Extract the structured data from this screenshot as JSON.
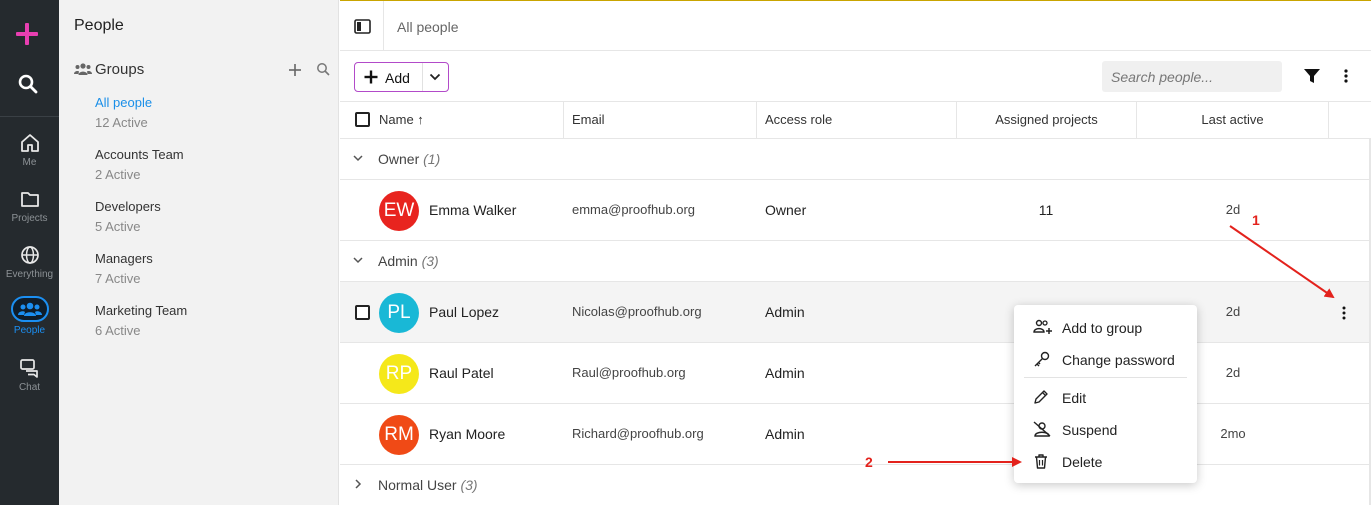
{
  "rail": {
    "items": [
      {
        "label": "Me",
        "icon": "home-icon"
      },
      {
        "label": "Projects",
        "icon": "folder-icon"
      },
      {
        "label": "Everything",
        "icon": "globe-icon"
      },
      {
        "label": "People",
        "icon": "people-icon",
        "active": true
      },
      {
        "label": "Chat",
        "icon": "chat-icon"
      }
    ],
    "accent": "#1b8ff2",
    "plus_color": "#e83fb1"
  },
  "panel": {
    "title": "People",
    "groups_label": "Groups",
    "groups": [
      {
        "name": "All people",
        "count": "12 Active",
        "selected": true
      },
      {
        "name": "Accounts Team",
        "count": "2 Active"
      },
      {
        "name": "Developers",
        "count": "5 Active"
      },
      {
        "name": "Managers",
        "count": "7 Active"
      },
      {
        "name": "Marketing Team",
        "count": "6 Active"
      }
    ]
  },
  "header": {
    "breadcrumb": "All people",
    "add_label": "Add",
    "search_placeholder": "Search people..."
  },
  "table": {
    "columns": [
      "Name ↑",
      "Email",
      "Access role",
      "Assigned projects",
      "Last active"
    ],
    "sections": [
      {
        "name": "Owner",
        "count": "(1)"
      },
      {
        "name": "Admin",
        "count": "(3)"
      },
      {
        "name": "Normal User",
        "count": "(3)"
      }
    ],
    "rows": [
      {
        "initials": "EW",
        "name": "Emma Walker",
        "email": "emma@proofhub.org",
        "role": "Owner",
        "projects": "11",
        "last_active": "2d",
        "color": "#e8241f"
      },
      {
        "initials": "PL",
        "name": "Paul Lopez",
        "email": "Nicolas@proofhub.org",
        "role": "Admin",
        "projects": "",
        "last_active": "2d",
        "color": "#19b8d6"
      },
      {
        "initials": "RP",
        "name": "Raul Patel",
        "email": "Raul@proofhub.org",
        "role": "Admin",
        "projects": "",
        "last_active": "2d",
        "color": "#f5e81a"
      },
      {
        "initials": "RM",
        "name": "Ryan Moore",
        "email": "Richard@proofhub.org",
        "role": "Admin",
        "projects": "",
        "last_active": "2mo",
        "color": "#f04a16"
      }
    ]
  },
  "context_menu": {
    "items": [
      "Add to group",
      "Change password",
      "Edit",
      "Suspend",
      "Delete"
    ]
  },
  "annotations": {
    "one": "1",
    "two": "2",
    "color": "#e3221c"
  }
}
